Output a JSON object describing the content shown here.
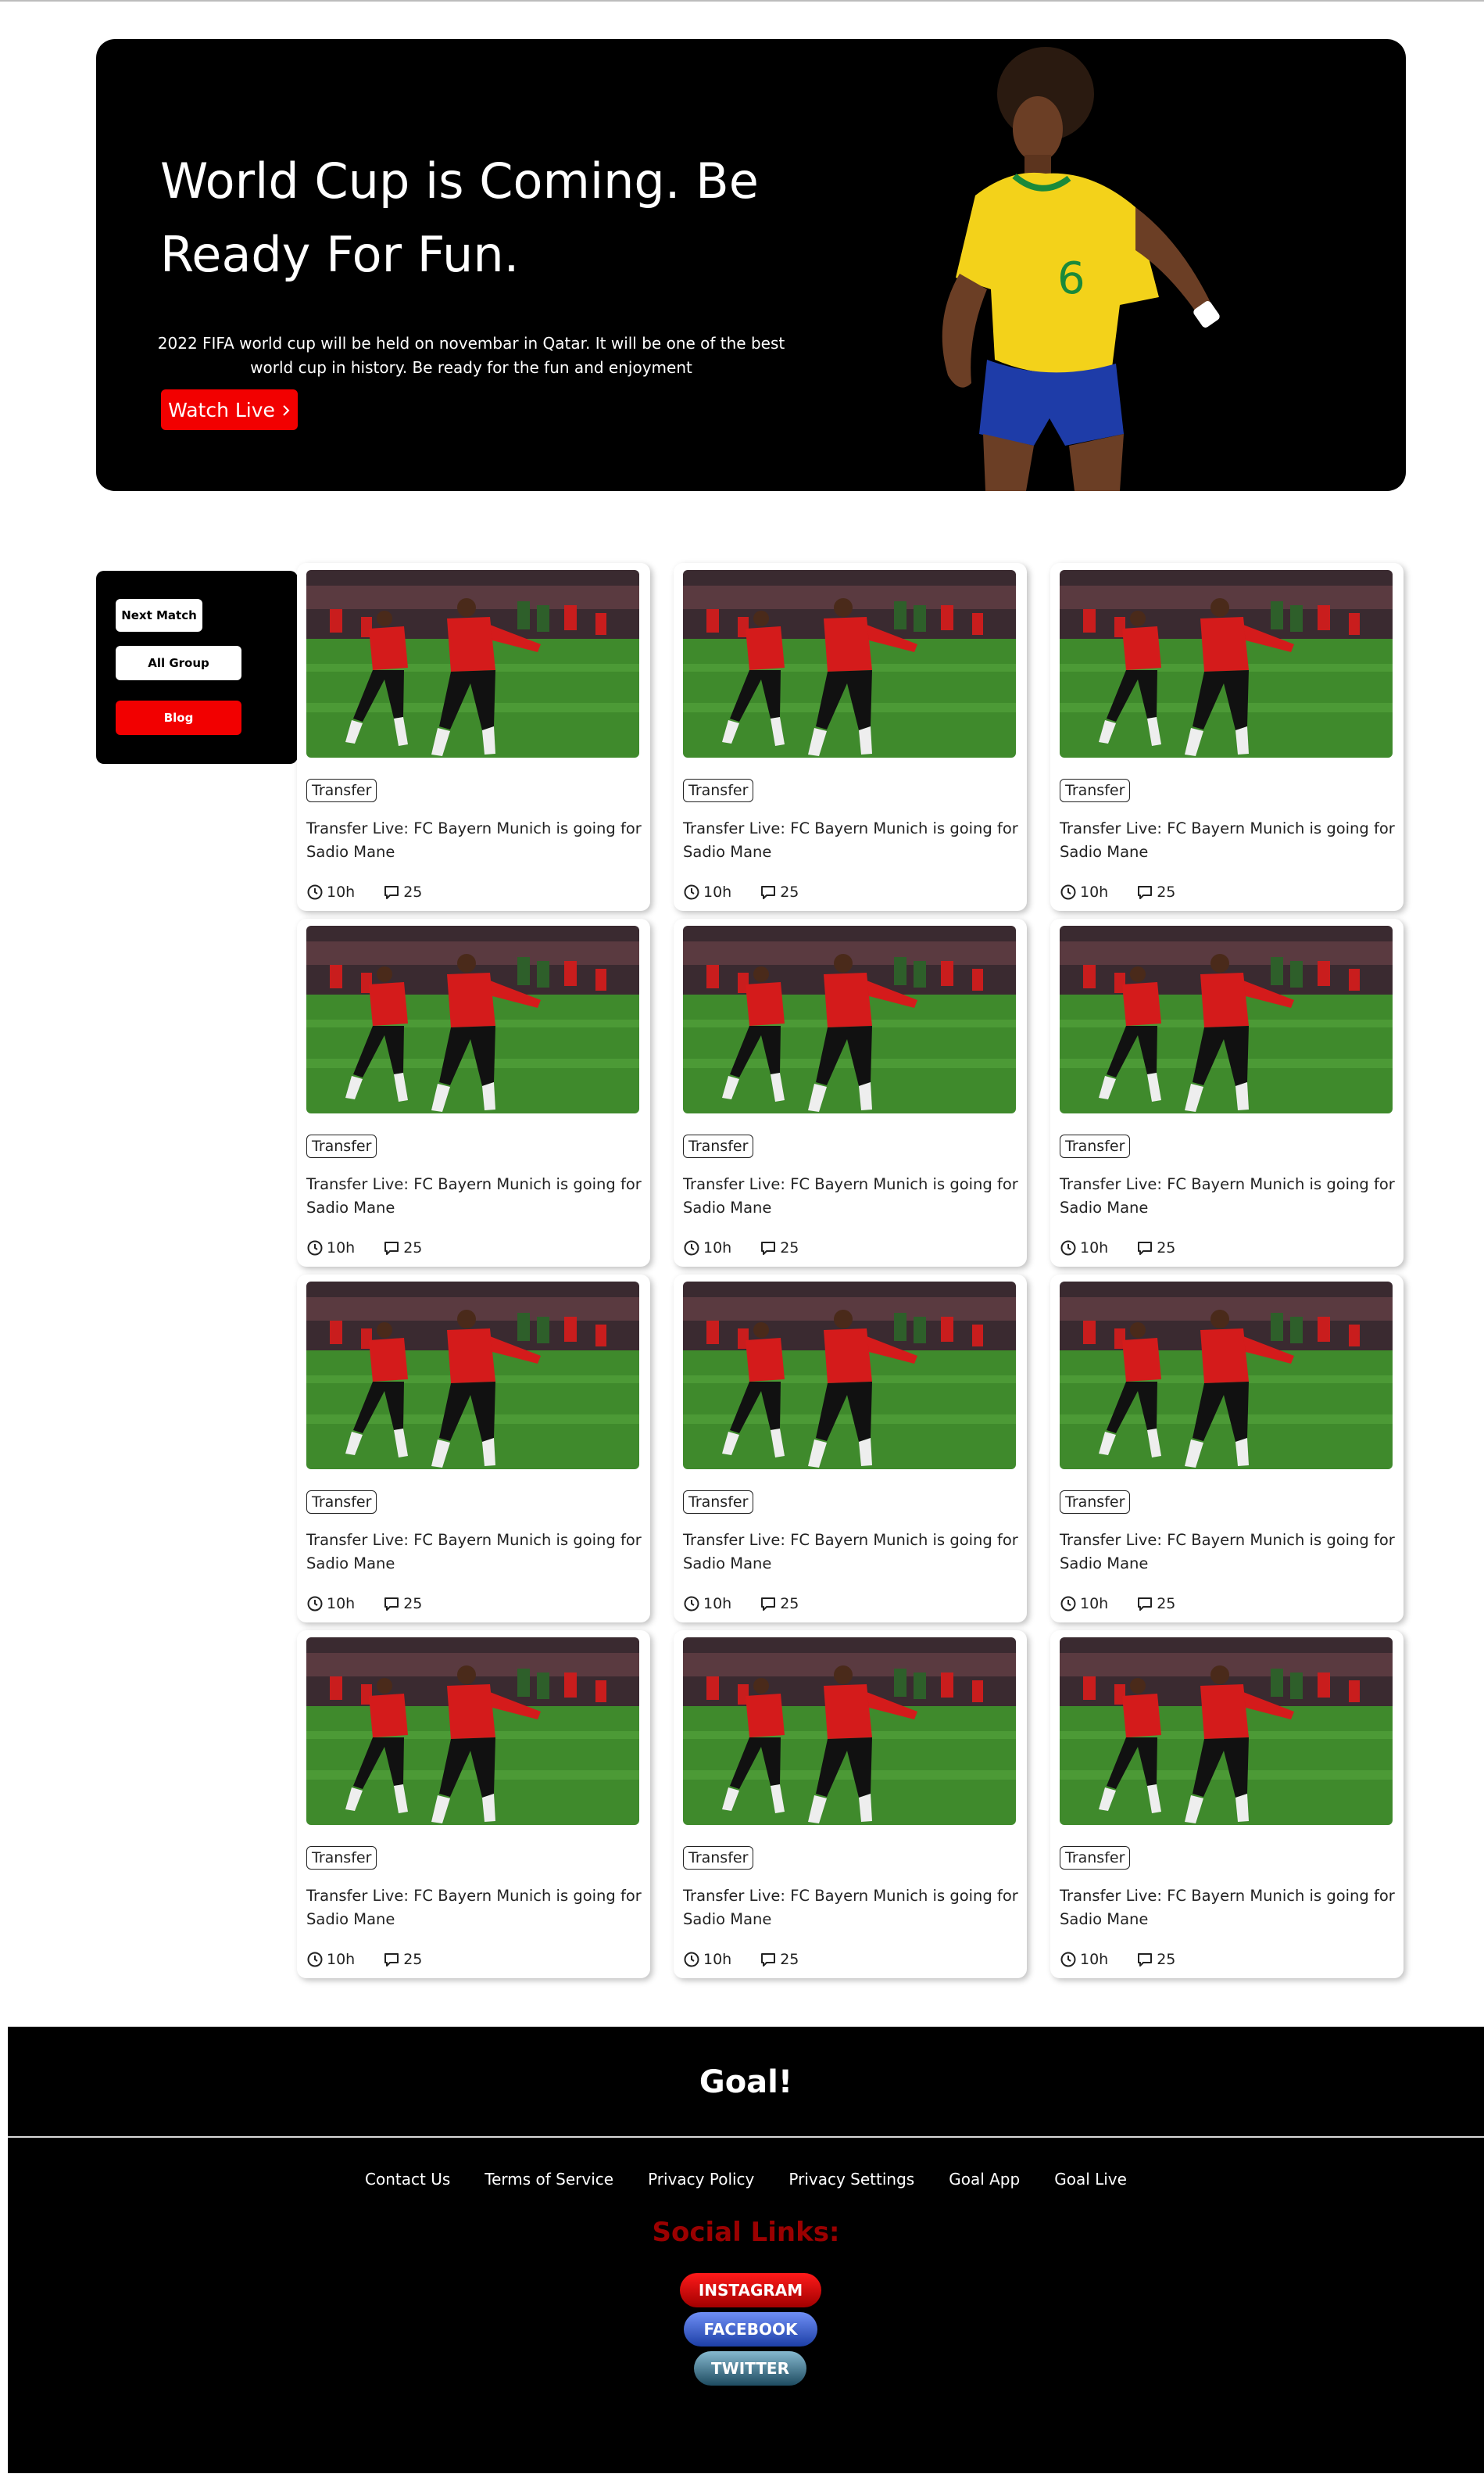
{
  "hero": {
    "title": "World Cup is Coming. Be Ready For Fun.",
    "description": "2022 FIFA world cup will be held on novembar in Qatar. It will be one of the best world cup in history. Be ready for the fun and enjoyment",
    "watch_button": "Watch Live",
    "watch_icon": "chevron-right-icon"
  },
  "sidebar": {
    "items": [
      {
        "label": "Next Match"
      },
      {
        "label": "All Group"
      },
      {
        "label": "Blog"
      }
    ]
  },
  "cards": [
    {
      "tag": "Transfer",
      "title": "Transfer Live: FC Bayern Munich is going for Sadio Mane",
      "time": "10h",
      "comments": "25"
    },
    {
      "tag": "Transfer",
      "title": "Transfer Live: FC Bayern Munich is going for Sadio Mane",
      "time": "10h",
      "comments": "25"
    },
    {
      "tag": "Transfer",
      "title": "Transfer Live: FC Bayern Munich is going for Sadio Mane",
      "time": "10h",
      "comments": "25"
    },
    {
      "tag": "Transfer",
      "title": "Transfer Live: FC Bayern Munich is going for Sadio Mane",
      "time": "10h",
      "comments": "25"
    },
    {
      "tag": "Transfer",
      "title": "Transfer Live: FC Bayern Munich is going for Sadio Mane",
      "time": "10h",
      "comments": "25"
    },
    {
      "tag": "Transfer",
      "title": "Transfer Live: FC Bayern Munich is going for Sadio Mane",
      "time": "10h",
      "comments": "25"
    },
    {
      "tag": "Transfer",
      "title": "Transfer Live: FC Bayern Munich is going for Sadio Mane",
      "time": "10h",
      "comments": "25"
    },
    {
      "tag": "Transfer",
      "title": "Transfer Live: FC Bayern Munich is going for Sadio Mane",
      "time": "10h",
      "comments": "25"
    },
    {
      "tag": "Transfer",
      "title": "Transfer Live: FC Bayern Munich is going for Sadio Mane",
      "time": "10h",
      "comments": "25"
    },
    {
      "tag": "Transfer",
      "title": "Transfer Live: FC Bayern Munich is going for Sadio Mane",
      "time": "10h",
      "comments": "25"
    },
    {
      "tag": "Transfer",
      "title": "Transfer Live: FC Bayern Munich is going for Sadio Mane",
      "time": "10h",
      "comments": "25"
    },
    {
      "tag": "Transfer",
      "title": "Transfer Live: FC Bayern Munich is going for Sadio Mane",
      "time": "10h",
      "comments": "25"
    }
  ],
  "footer": {
    "logo": "Goal!",
    "links": [
      "Contact Us",
      "Terms of Service",
      "Privacy Policy",
      "Privacy Settings",
      "Goal App",
      "Goal Live"
    ],
    "social_title": "Social Links:",
    "social": [
      {
        "label": "INSTAGRAM"
      },
      {
        "label": "FACEBOOK"
      },
      {
        "label": "TWITTER"
      }
    ]
  }
}
